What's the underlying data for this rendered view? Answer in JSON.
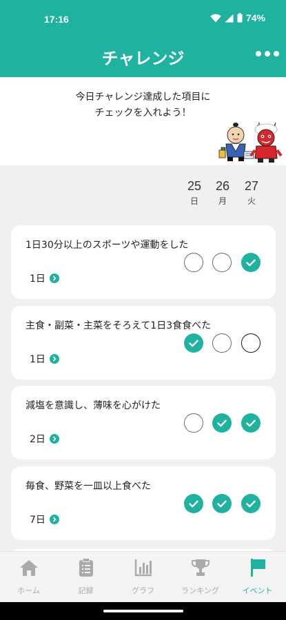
{
  "status": {
    "time": "17:16",
    "battery": "74%"
  },
  "header": {
    "title": "チャレンジ"
  },
  "intro": {
    "line1": "今日チャレンジ達成した項目に",
    "line2": "チェックを入れよう！"
  },
  "days": [
    {
      "num": "25",
      "weekday": "日"
    },
    {
      "num": "26",
      "weekday": "月"
    },
    {
      "num": "27",
      "weekday": "火"
    }
  ],
  "challenges": [
    {
      "title": "1日30分以上のスポーツや運動をした",
      "days": "1日",
      "checks": [
        false,
        false,
        true
      ]
    },
    {
      "title": "主食・副菜・主菜をそろえて1日3食食べた",
      "days": "1日",
      "checks": [
        true,
        false,
        false
      ]
    },
    {
      "title": "減塩を意識し、薄味を心がけた",
      "days": "2日",
      "checks": [
        false,
        true,
        true
      ]
    },
    {
      "title": "毎食、野菜を一皿以上食べた",
      "days": "7日",
      "checks": [
        true,
        true,
        true
      ]
    }
  ],
  "tabs": [
    {
      "label": "ホーム",
      "icon": "home-icon"
    },
    {
      "label": "記録",
      "icon": "clipboard-icon"
    },
    {
      "label": "グラフ",
      "icon": "bar-chart-icon"
    },
    {
      "label": "ランキング",
      "icon": "trophy-icon"
    },
    {
      "label": "イベント",
      "icon": "flag-icon"
    }
  ],
  "colors": {
    "accent": "#20b2a0",
    "background": "#f0f0f0",
    "inactive": "#aaaaaa"
  }
}
